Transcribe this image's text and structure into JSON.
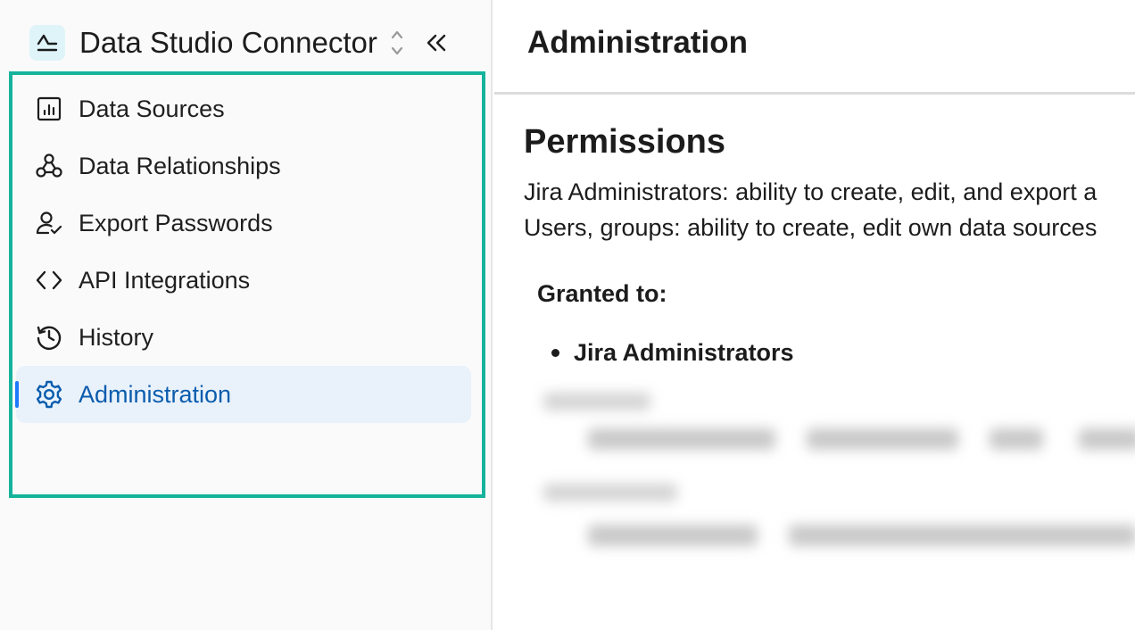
{
  "sidebar": {
    "app_title": "Data Studio Connector",
    "items": [
      {
        "label": "Data Sources",
        "icon": "chart-icon"
      },
      {
        "label": "Data Relationships",
        "icon": "webhook-icon"
      },
      {
        "label": "Export Passwords",
        "icon": "user-check-icon"
      },
      {
        "label": "API Integrations",
        "icon": "code-icon"
      },
      {
        "label": "History",
        "icon": "history-icon"
      },
      {
        "label": "Administration",
        "icon": "gear-icon",
        "active": true
      }
    ]
  },
  "main": {
    "page_title": "Administration",
    "section_title": "Permissions",
    "description_line1": "Jira Administrators: ability to create, edit, and export a",
    "description_line2": "Users, groups: ability to create, edit own data sources",
    "granted_label": "Granted to:",
    "granted_items": [
      "Jira Administrators"
    ]
  },
  "colors": {
    "accent": "#0b5cad",
    "highlight_frame": "#15b39b",
    "active_bg": "#e9f2fb",
    "active_bar": "#1d7afc"
  }
}
